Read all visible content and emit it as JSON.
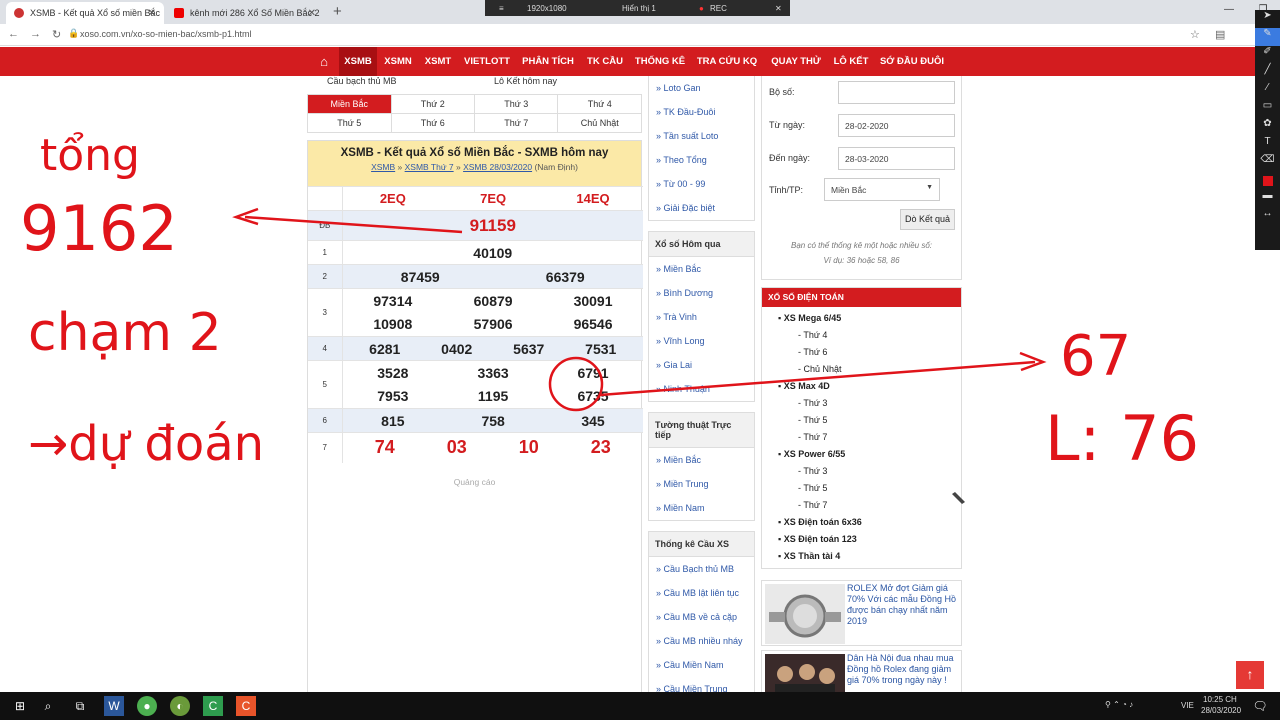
{
  "browser": {
    "tabs": [
      {
        "title": "XSMB - Kết quả Xổ số miền Bắc"
      },
      {
        "title": "kênh mới 286 Xổ Số Miền Bắc 2"
      }
    ],
    "url": "xoso.com.vn/xo-so-mien-bac/xsmb-p1.html"
  },
  "recorder": {
    "resolution": "1920x1080",
    "label": "Hiển thị 1",
    "rec": "REC"
  },
  "nav": [
    "XSMB",
    "XSMN",
    "XSMT",
    "VIETLOTT",
    "PHÂN TÍCH",
    "TK CẦU",
    "THỐNG KÊ",
    "TRA CỨU KQ",
    "QUAY THỬ",
    "LÔ KẾT",
    "SỚ ĐẦU ĐUÔI"
  ],
  "top_links": [
    "Cầu bạch thủ MB",
    "Lô Kết hôm nay"
  ],
  "day_tabs": [
    [
      "Miền Bắc",
      "Thứ 2",
      "Thứ 3",
      "Thứ 4"
    ],
    [
      "Thứ 5",
      "Thứ 6",
      "Thứ 7",
      "Chủ Nhật"
    ]
  ],
  "result": {
    "title": "XSMB - Kết quả Xổ số Miền Bắc - SXMB hôm nay",
    "crumbs": [
      "XSMB",
      "XSMB Thứ 7",
      "XSMB 28/03/2020"
    ],
    "crumb_tail": "(Nam Định)",
    "codes": [
      "2EQ",
      "7EQ",
      "14EQ"
    ],
    "prizes": [
      {
        "label": "ĐB",
        "values": [
          "91159"
        ]
      },
      {
        "label": "1",
        "values": [
          "40109"
        ]
      },
      {
        "label": "2",
        "values": [
          "87459",
          "66379"
        ]
      },
      {
        "label": "3",
        "values": [
          "97314",
          "60879",
          "30091",
          "10908",
          "57906",
          "96546"
        ]
      },
      {
        "label": "4",
        "values": [
          "6281",
          "0402",
          "5637",
          "7531"
        ]
      },
      {
        "label": "5",
        "values": [
          "3528",
          "3363",
          "6791",
          "7953",
          "1195",
          "6735"
        ]
      },
      {
        "label": "6",
        "values": [
          "815",
          "758",
          "345"
        ]
      },
      {
        "label": "7",
        "values": [
          "74",
          "03",
          "10",
          "23"
        ]
      }
    ],
    "ad": "Quảng cáo"
  },
  "mid": {
    "links_top": [
      "» Loto Gan",
      "» TK Đầu-Đuôi",
      "» Tần suất Loto",
      "» Theo Tổng",
      "» Từ 00 - 99",
      "» Giải Đặc biệt"
    ],
    "today_title": "Xổ số Hôm qua",
    "today": [
      "» Miền Bắc",
      "» Bình Dương",
      "» Trà Vinh",
      "» Vĩnh Long",
      "» Gia Lai",
      "» Ninh Thuận"
    ],
    "live_title": "Tường thuật Trực tiếp",
    "live": [
      "» Miền Bắc",
      "» Miền Trung",
      "» Miền Nam"
    ],
    "stat_title": "Thống kê Cầu XS",
    "stat": [
      "» Cầu Bạch thủ MB",
      "» Cầu MB lật liên tục",
      "» Cầu MB về cả cặp",
      "» Cầu MB nhiều nháy",
      "» Cầu Miền Nam",
      "» Cầu Miền Trung"
    ]
  },
  "form": {
    "so_label": "Bộ số:",
    "from_label": "Từ ngày:",
    "from": "28-02-2020",
    "to_label": "Đến ngày:",
    "to": "28-03-2020",
    "prov_label": "Tỉnh/TP:",
    "prov": "Miền Bắc",
    "button": "Dò Kết quả",
    "hint1": "Bạn có thể thống kê một hoặc nhiều số:",
    "hint2": "Ví dụ: 36 hoặc 58, 86"
  },
  "dientoan": {
    "title": "XỔ SỐ ĐIỆN TOÁN",
    "mega": "XS Mega 6/45",
    "mega_days": [
      "Thứ 4",
      "Thứ 6",
      "Chủ Nhật"
    ],
    "max": "XS Max 4D",
    "max_days": [
      "Thứ 3",
      "Thứ 5",
      "Thứ 7"
    ],
    "power": "XS Power 6/55",
    "power_days": [
      "Thứ 3",
      "Thứ 5",
      "Thứ 7"
    ],
    "others": [
      "XS Điện toán 6x36",
      "XS Điện toán 123",
      "XS Thần tài 4"
    ]
  },
  "ads": [
    "ROLEX Mở đợt Giảm giá 70% Với các mẫu Đồng Hồ được bán chạy nhất năm 2019",
    "Dân Hà Nội đua nhau mua Đồng hồ Rolex đang giảm giá 70% trong ngày này !"
  ],
  "annotations": {
    "left1": "tổng",
    "left2": "9162",
    "left3": "chạm 2",
    "left4": "→dự đoán",
    "right1": "67",
    "right2": "L: 76"
  },
  "taskbar": {
    "lang": "VIE",
    "time": "10:25 CH",
    "date": "28/03/2020"
  }
}
